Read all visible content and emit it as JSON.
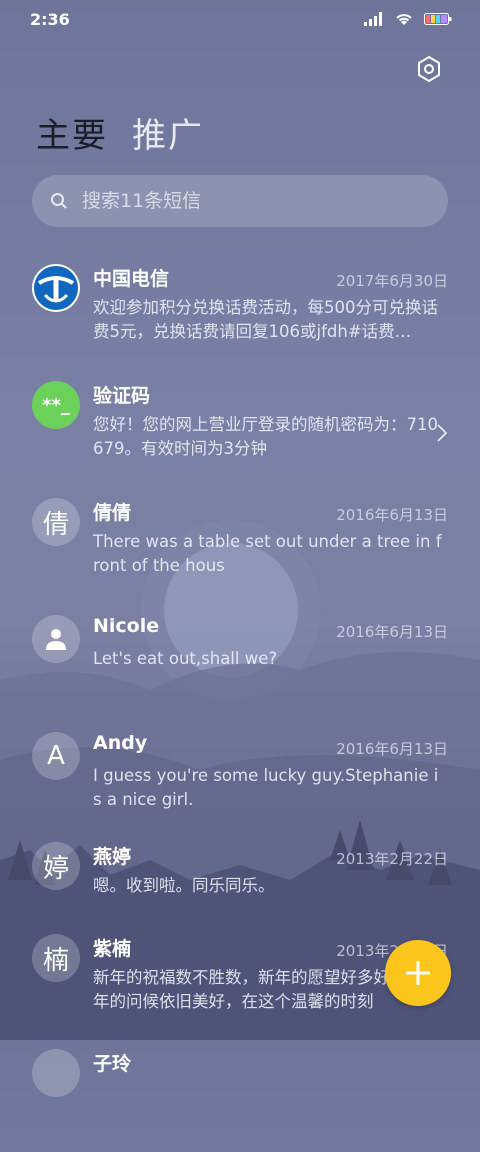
{
  "status": {
    "time": "2:36"
  },
  "tabs": [
    {
      "label": "主要"
    },
    {
      "label": "推广"
    }
  ],
  "search": {
    "placeholder": "搜索11条短信"
  },
  "conversations": [
    {
      "name": "中国电信",
      "date": "2017年6月30日",
      "preview": "欢迎参加积分兑换话费活动，每500分可兑换话费5元，兑换话费请回复106或jfdh#话费…",
      "avatar": "china-telecom-logo"
    },
    {
      "name": "验证码",
      "date": "",
      "preview": "您好！您的网上营业厅登录的随机密码为：710679。有效时间为3分钟",
      "avatar_text": "**_"
    },
    {
      "name": "倩倩",
      "date": "2016年6月13日",
      "preview": "There was a table set out under a tree in front of the hous",
      "avatar_text": "倩"
    },
    {
      "name": "Nicole",
      "date": "2016年6月13日",
      "preview": "Let's eat out,shall we?",
      "avatar": "person-icon"
    },
    {
      "name": "Andy",
      "date": "2016年6月13日",
      "preview": "I guess you're some lucky guy.Stephanie is a nice girl.",
      "avatar_text": "A"
    },
    {
      "name": "燕婷",
      "date": "2013年2月22日",
      "preview": "嗯。收到啦。同乐同乐。",
      "avatar_text": "婷"
    },
    {
      "name": "紫楠",
      "date": "2013年2月22日",
      "preview": "新年的祝福数不胜数，新年的愿望好多好多，新年的问候依旧美好，在这个温馨的时刻",
      "avatar_text": "楠"
    },
    {
      "name": "子玲",
      "date": "",
      "preview": "",
      "avatar_text": ""
    }
  ],
  "colors": {
    "accent": "#fcc51b",
    "green_badge": "#6bd15b"
  }
}
